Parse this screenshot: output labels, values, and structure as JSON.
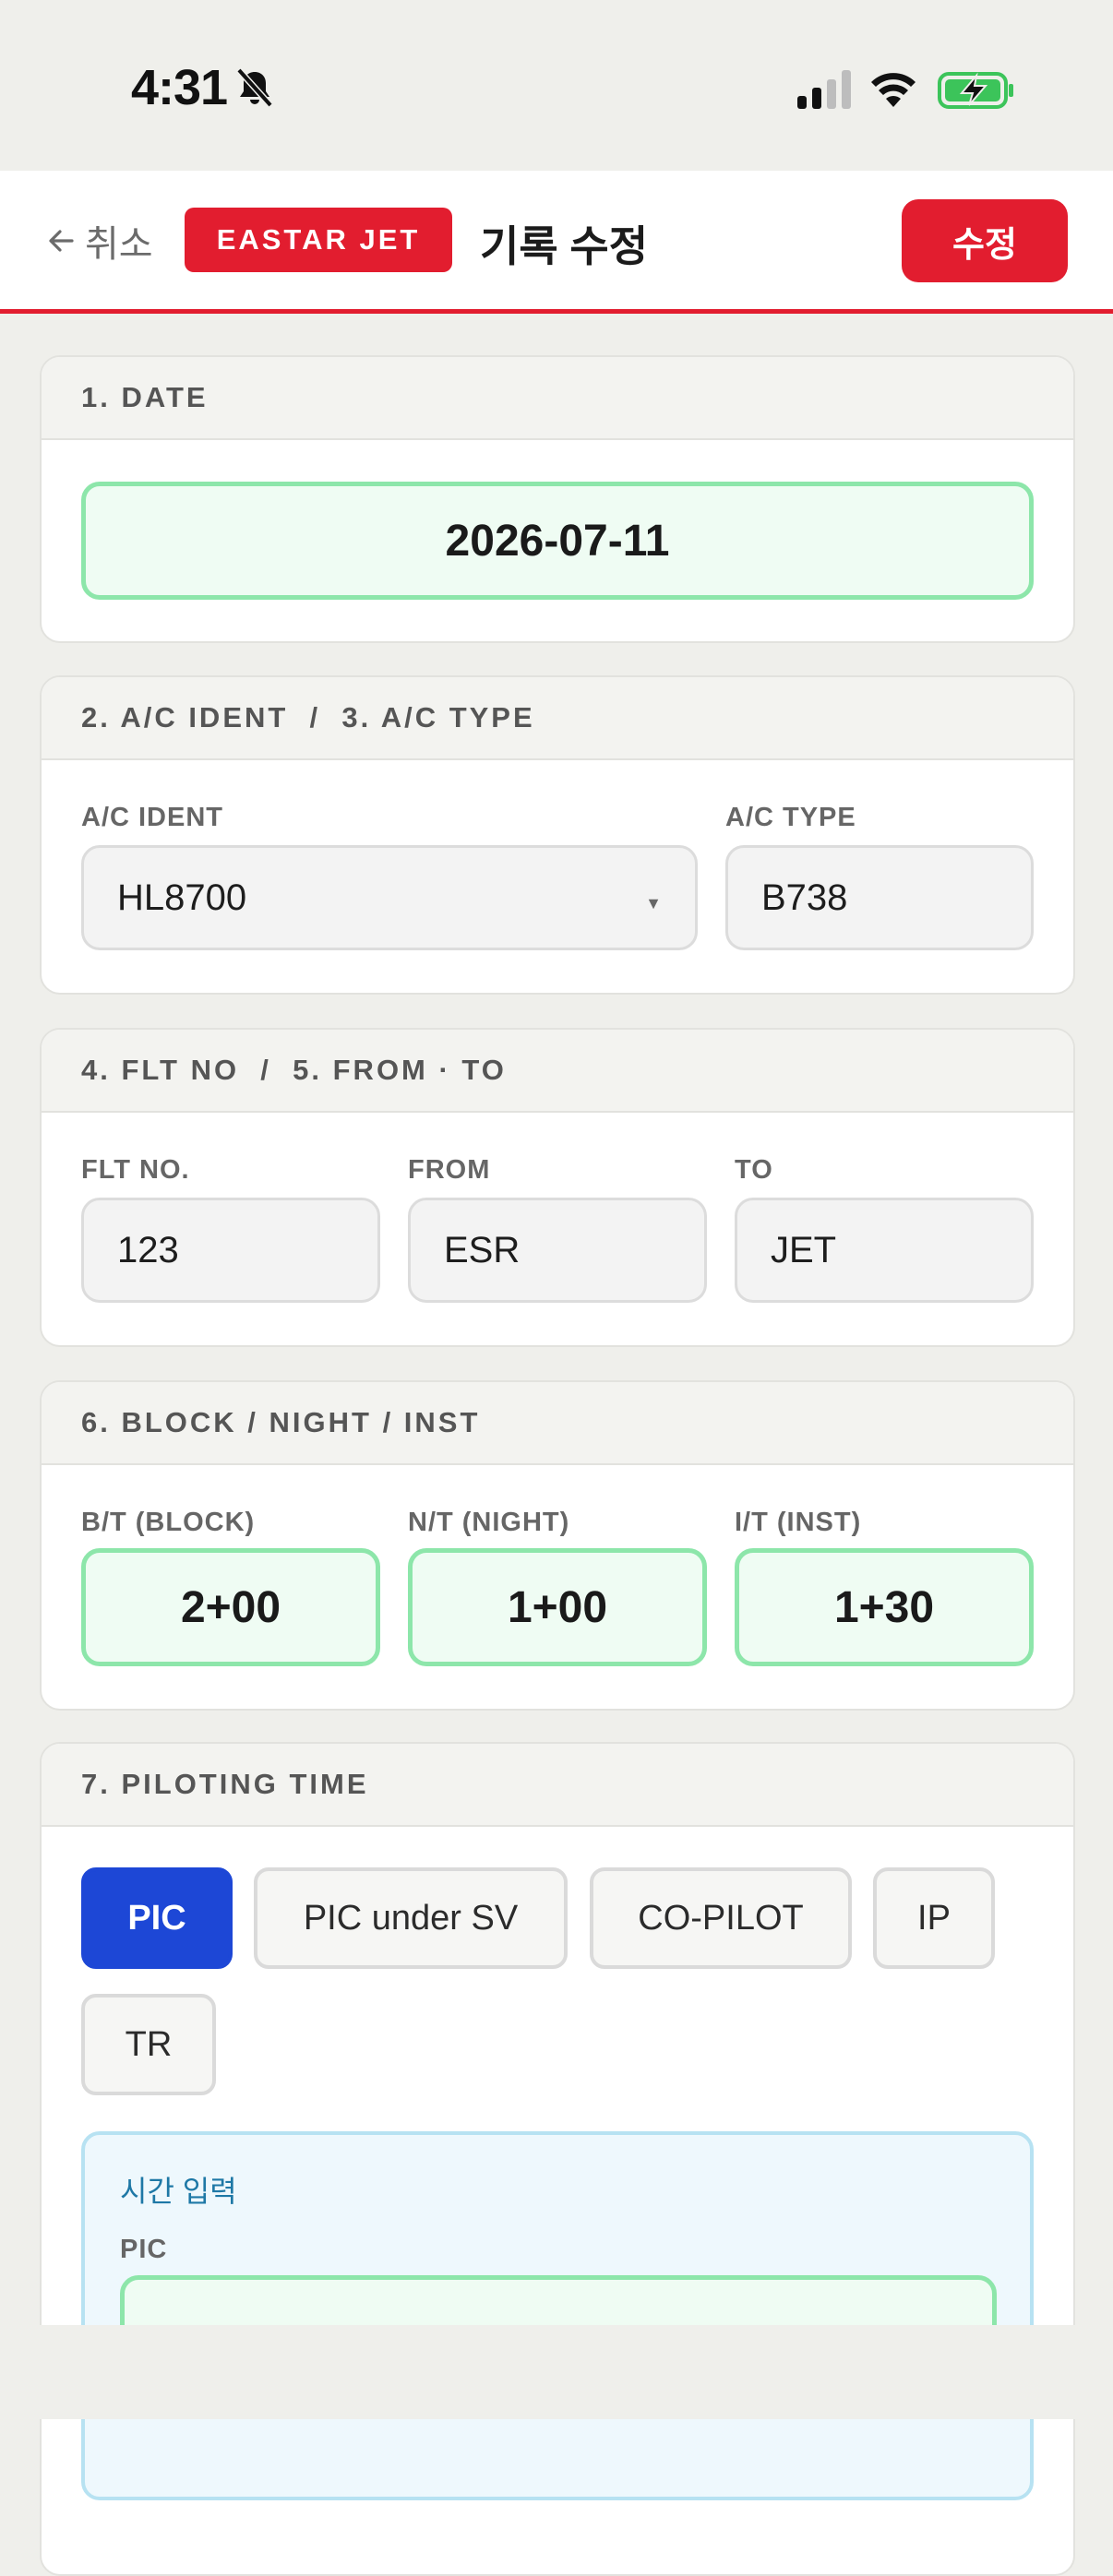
{
  "status_bar": {
    "time": "4:31",
    "bell_icon": "bell-slash-icon",
    "signal_icon": "cellular-signal-icon",
    "wifi_icon": "wifi-icon",
    "battery_icon": "battery-charging-icon"
  },
  "header": {
    "back_label": "취소",
    "brand": "EASTAR JET",
    "title": "기록 수정",
    "save_label": "수정",
    "accent": "#e21d2f"
  },
  "date_section": {
    "title": "1. DATE",
    "value": "2026-07-11"
  },
  "aircraft_section": {
    "title": "2. A/C IDENT  /  3. A/C TYPE",
    "ident_label": "A/C IDENT",
    "ident_value": "HL8700",
    "type_label": "A/C TYPE",
    "type_value": "B738"
  },
  "flight_section": {
    "title": "4. FLT NO  /  5. FROM · TO",
    "flt_label": "FLT NO.",
    "flt_value": "123",
    "from_label": "FROM",
    "from_value": "ESR",
    "to_label": "TO",
    "to_value": "JET"
  },
  "times_section": {
    "title": "6. BLOCK / NIGHT / INST",
    "block_label": "B/T (BLOCK)",
    "block_value": "2+00",
    "night_label": "N/T (NIGHT)",
    "night_value": "1+00",
    "inst_label": "I/T (INST)",
    "inst_value": "1+30"
  },
  "piloting_section": {
    "title": "7. PILOTING TIME",
    "options": [
      "PIC",
      "PIC under SV",
      "CO-PILOT",
      "IP",
      "TR"
    ],
    "selected": "PIC",
    "time_input_title": "시간 입력",
    "time_input_label": "PIC",
    "active_color": "#1d47d6"
  }
}
